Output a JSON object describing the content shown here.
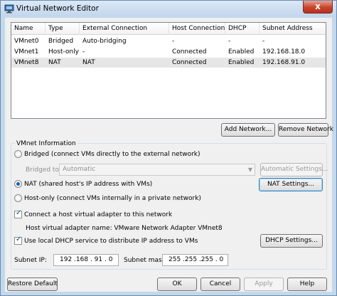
{
  "window": {
    "title": "Virtual Network Editor",
    "close_glyph": "x"
  },
  "table": {
    "headers": [
      "Name",
      "Type",
      "External Connection",
      "Host Connection",
      "DHCP",
      "Subnet Address"
    ],
    "rows": [
      [
        "VMnet0",
        "Bridged",
        "Auto-bridging",
        "-",
        "-",
        "-"
      ],
      [
        "VMnet1",
        "Host-only",
        "-",
        "Connected",
        "Enabled",
        "192.168.18.0"
      ],
      [
        "VMnet8",
        "NAT",
        "NAT",
        "Connected",
        "Enabled",
        "192.168.91.0"
      ]
    ]
  },
  "buttons": {
    "add_network": "Add Network...",
    "remove_network": "Remove Network",
    "automatic_settings": "Automatic Settings...",
    "nat_settings": "NAT Settings...",
    "dhcp_settings": "DHCP Settings...",
    "restore_default": "Restore Default",
    "ok": "OK",
    "cancel": "Cancel",
    "apply": "Apply",
    "help": "Help"
  },
  "vmnet_info": {
    "group_title": "VMnet Information",
    "bridged_label": "Bridged (connect VMs directly to the external network)",
    "bridged_to_label": "Bridged to:",
    "bridged_to_value": "Automatic",
    "nat_label": "NAT (shared host's IP address with VMs)",
    "hostonly_label": "Host-only (connect VMs internally in a private network)",
    "connect_adapter_label": "Connect a host virtual adapter to this network",
    "adapter_name_label": "Host virtual adapter name: VMware Network Adapter VMnet8",
    "use_dhcp_label": "Use local DHCP service to distribute IP address to VMs",
    "selected_mode": "NAT",
    "connect_adapter_checked": true,
    "use_dhcp_checked": true
  },
  "subnet": {
    "ip_label": "Subnet IP:",
    "ip_value": "192 .168 . 91 . 0",
    "mask_label": "Subnet mask:",
    "mask_value": "255 .255 .255 . 0"
  },
  "colors": {
    "selection": "#e6e6e6",
    "accent": "#3c7fb1"
  },
  "icons": {
    "app": "network-app-icon",
    "dropdown": "chevron-down-icon"
  }
}
